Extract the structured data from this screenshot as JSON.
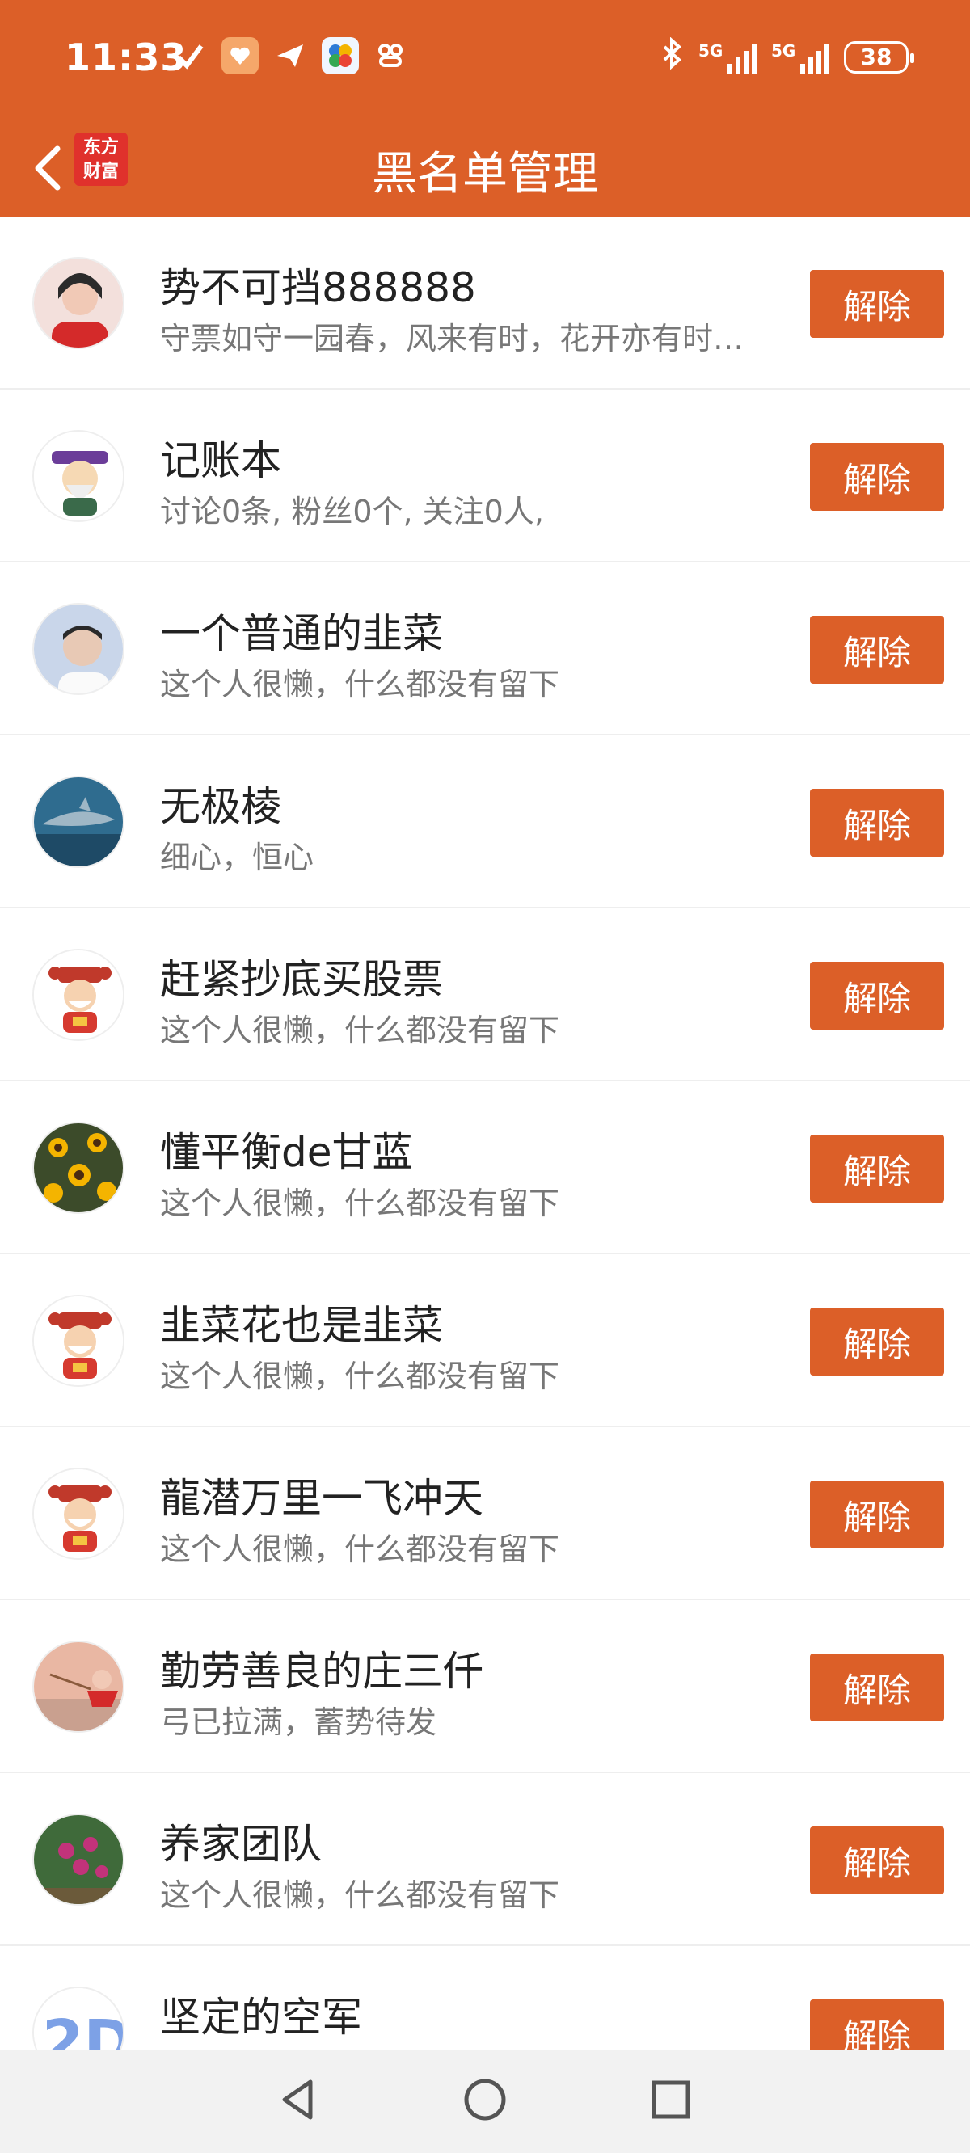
{
  "status_bar": {
    "time": "11:33",
    "network_1": "5G",
    "network_2": "5G",
    "battery": "38"
  },
  "header": {
    "title": "黑名单管理",
    "logo_line1": "东方",
    "logo_line2": "财富",
    "accent_color": "#dc5f28"
  },
  "list": [
    {
      "name": "势不可挡888888",
      "desc": "守票如守一园春，风来有时，花开亦有时…",
      "action": "解除",
      "avatar": "photo-woman"
    },
    {
      "name": "记账本",
      "desc": "讨论0条, 粉丝0个, 关注0人,",
      "action": "解除",
      "avatar": "cartoon-god"
    },
    {
      "name": "一个普通的韭菜",
      "desc": "这个人很懒，什么都没有留下",
      "action": "解除",
      "avatar": "photo-man"
    },
    {
      "name": "无极棱",
      "desc": "细心，恒心",
      "action": "解除",
      "avatar": "photo-shark"
    },
    {
      "name": "赶紧抄底买股票",
      "desc": "这个人很懒，什么都没有留下",
      "action": "解除",
      "avatar": "cartoon-fortune"
    },
    {
      "name": "懂平衡de甘蓝",
      "desc": "这个人很懒，什么都没有留下",
      "action": "解除",
      "avatar": "photo-flowers"
    },
    {
      "name": "韭菜花也是韭菜",
      "desc": "这个人很懒，什么都没有留下",
      "action": "解除",
      "avatar": "cartoon-fortune"
    },
    {
      "name": "龍潜万里一飞冲天",
      "desc": "这个人很懒，什么都没有留下",
      "action": "解除",
      "avatar": "cartoon-fortune"
    },
    {
      "name": "勤劳善良的庄三仟",
      "desc": "弓已拉满，蓄势待发",
      "action": "解除",
      "avatar": "photo-sunset"
    },
    {
      "name": "养家团队",
      "desc": "这个人很懒，什么都没有留下",
      "action": "解除",
      "avatar": "photo-plant"
    },
    {
      "name": "坚定的空军",
      "desc": "",
      "action": "解除",
      "avatar": "graphic-blue"
    }
  ]
}
